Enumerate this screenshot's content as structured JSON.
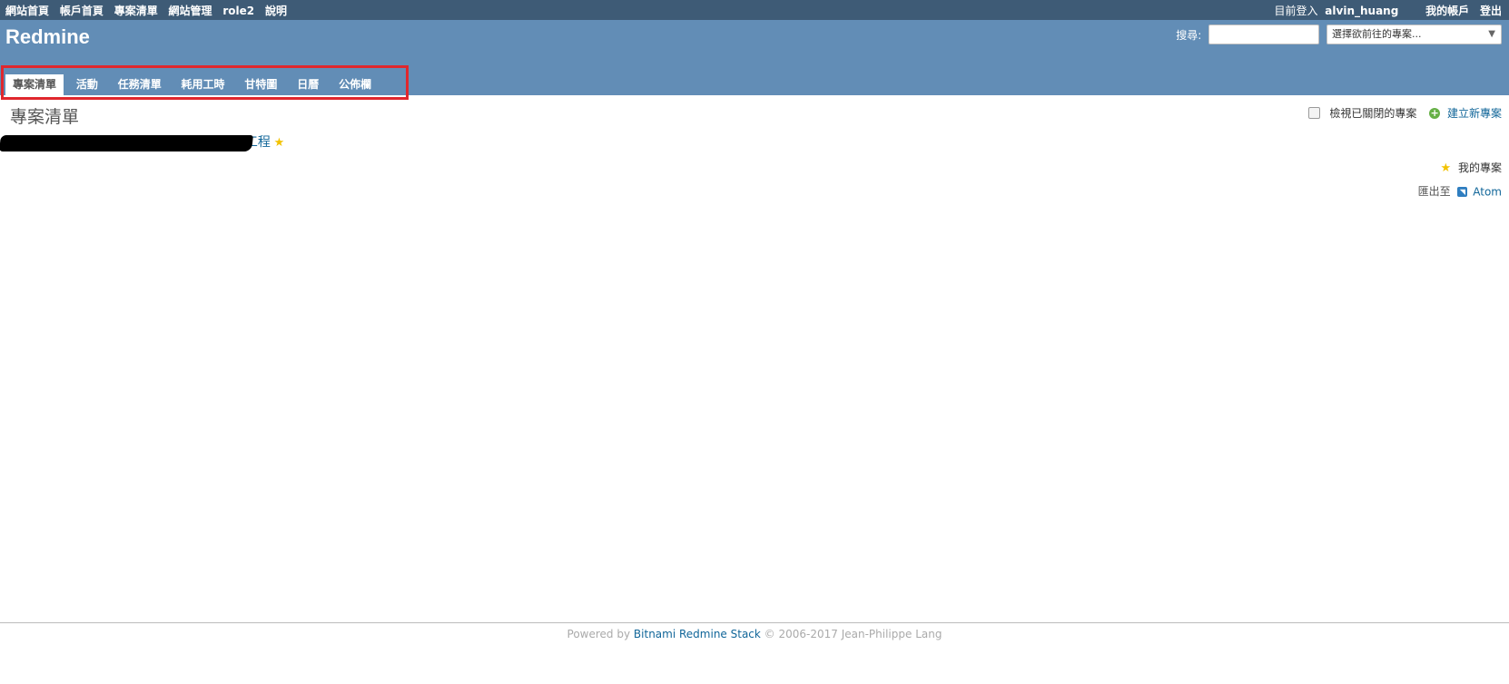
{
  "top_menu": {
    "items": [
      "網站首頁",
      "帳戶首頁",
      "專案清單",
      "網站管理",
      "role2",
      "說明"
    ],
    "logged_in_label": "目前登入",
    "username": "alvin_huang",
    "my_account": "我的帳戶",
    "logout": "登出"
  },
  "header": {
    "title": "Redmine",
    "search_label": "搜尋:",
    "jump_placeholder": "選擇欲前往的專案..."
  },
  "main_menu": {
    "tabs": [
      "專案清單",
      "活動",
      "任務清單",
      "耗用工時",
      "甘特圖",
      "日曆",
      "公佈欄"
    ],
    "selected": "專案清單"
  },
  "content": {
    "title": "專案清單",
    "closed_checkbox_label": "檢視已關閉的專案",
    "new_project": "建立新專案",
    "project_suffix": "工程",
    "my_projects": "我的專案",
    "export_label": "匯出至",
    "atom": "Atom"
  },
  "footer": {
    "prefix": "Powered by",
    "link": "Bitnami Redmine Stack",
    "suffix": "© 2006-2017 Jean-Philippe Lang"
  },
  "colors": {
    "top_menu_bg": "#3e5b76",
    "header_bg": "#628db6",
    "link": "#116699",
    "highlight": "#e0272d"
  }
}
